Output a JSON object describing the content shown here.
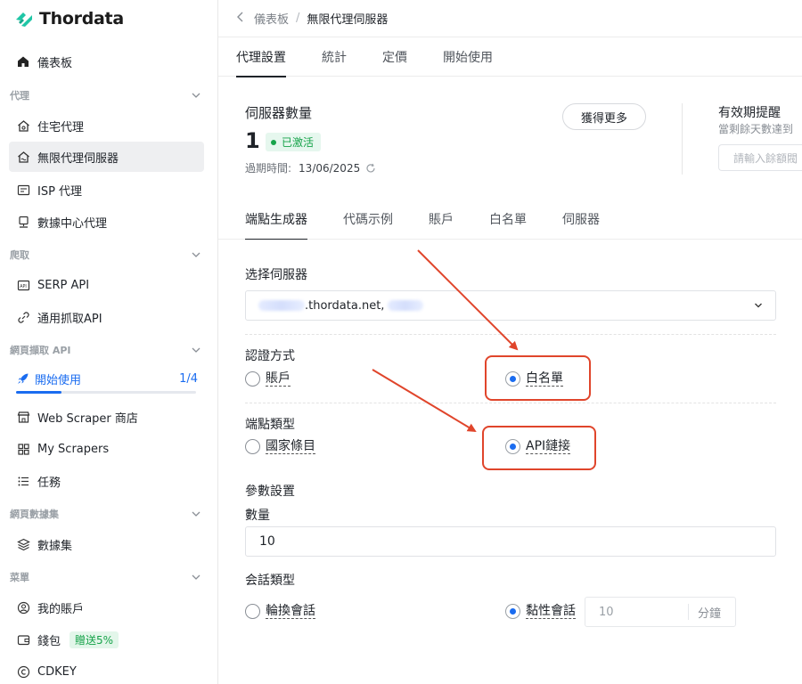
{
  "app": {
    "logo_text": "Thordata"
  },
  "sidebar": {
    "dashboard": "儀表板",
    "sections": {
      "proxy": "代理",
      "scraping": "爬取",
      "web_scraper_api": "網頁擷取 API",
      "web_dataset": "網頁數據集",
      "menu": "菜單"
    },
    "items": {
      "residential": "住宅代理",
      "unlimited": "無限代理伺服器",
      "isp": "ISP 代理",
      "datacenter": "數據中心代理",
      "serp": "SERP API",
      "universal": "通用抓取API",
      "getting_started": "開始使用",
      "getting_started_progress": "1/4",
      "getting_started_fraction": 0.25,
      "store": "Web Scraper 商店",
      "my_scrapers": "My Scrapers",
      "tasks": "任務",
      "dataset": "數據集",
      "account": "我的賬戶",
      "wallet": "錢包",
      "wallet_badge": "贈送5%",
      "cdkey": "CDKEY"
    }
  },
  "breadcrumb": {
    "parent": "儀表板",
    "sep": "/",
    "current": "無限代理伺服器"
  },
  "main_tabs": [
    "代理設置",
    "統計",
    "定價",
    "開始使用"
  ],
  "server": {
    "title": "伺服器數量",
    "count": "1",
    "status": "已激活",
    "expire_label": "過期時間:",
    "expire_date": "13/06/2025",
    "more_button": "獲得更多",
    "expiry_title": "有效期提醒",
    "expiry_sub": "當剩餘天數達到",
    "expiry_placeholder": "請輸入餘額閥"
  },
  "sub_tabs": [
    "端點生成器",
    "代碼示例",
    "賬戶",
    "白名單",
    "伺服器"
  ],
  "form": {
    "select_server_label": "选择伺服器",
    "select_server_value": ".thordata.net,",
    "auth_label": "認證方式",
    "auth_options": [
      "賬戶",
      "白名單"
    ],
    "endpoint_label": "端點類型",
    "endpoint_options": [
      "國家條目",
      "API鏈接"
    ],
    "params_label": "參數設置",
    "quantity_label": "數量",
    "quantity_value": "10",
    "session_label": "会話類型",
    "session_options": [
      "輪換會話",
      "黏性會話"
    ],
    "sticky_minutes": "10",
    "sticky_unit": "分鐘"
  },
  "colors": {
    "accent": "#1a6cf0",
    "annotation": "#e0452b",
    "active_green": "#17a34a"
  }
}
